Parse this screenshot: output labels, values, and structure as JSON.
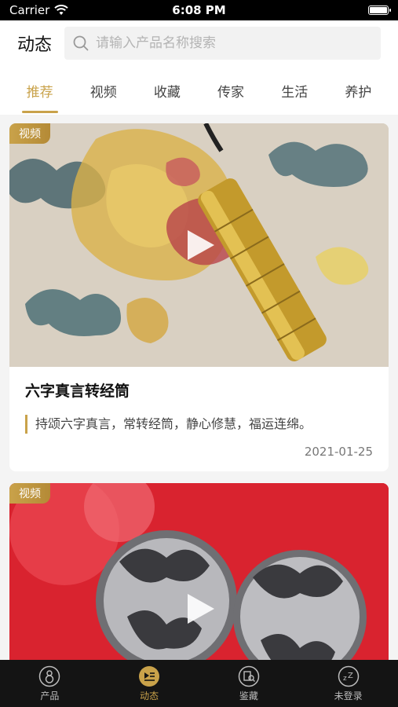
{
  "status_bar": {
    "carrier": "Carrier",
    "time": "6:08 PM"
  },
  "header": {
    "title": "动态",
    "search_placeholder": "请输入产品名称搜索"
  },
  "tabs": [
    {
      "label": "推荐",
      "active": true
    },
    {
      "label": "视频",
      "active": false
    },
    {
      "label": "收藏",
      "active": false
    },
    {
      "label": "传家",
      "active": false
    },
    {
      "label": "生活",
      "active": false
    },
    {
      "label": "养护",
      "active": false
    }
  ],
  "feed": [
    {
      "badge": "视频",
      "image_icon": "play-icon",
      "title": "六字真言转经筒",
      "description": "持颂六字真言，常转经筒，静心修慧，福运连绵。",
      "date": "2021-01-25"
    },
    {
      "badge": "视频",
      "image_icon": "play-icon"
    }
  ],
  "tabbar": [
    {
      "label": "产品",
      "icon": "gourd-icon",
      "active": false
    },
    {
      "label": "动态",
      "icon": "play-list-icon",
      "active": true
    },
    {
      "label": "鉴藏",
      "icon": "appraise-icon",
      "active": false
    },
    {
      "label": "未登录",
      "icon": "sleep-icon",
      "active": false
    }
  ],
  "colors": {
    "accent": "#c9a24a",
    "tabbar_bg": "#141414"
  }
}
